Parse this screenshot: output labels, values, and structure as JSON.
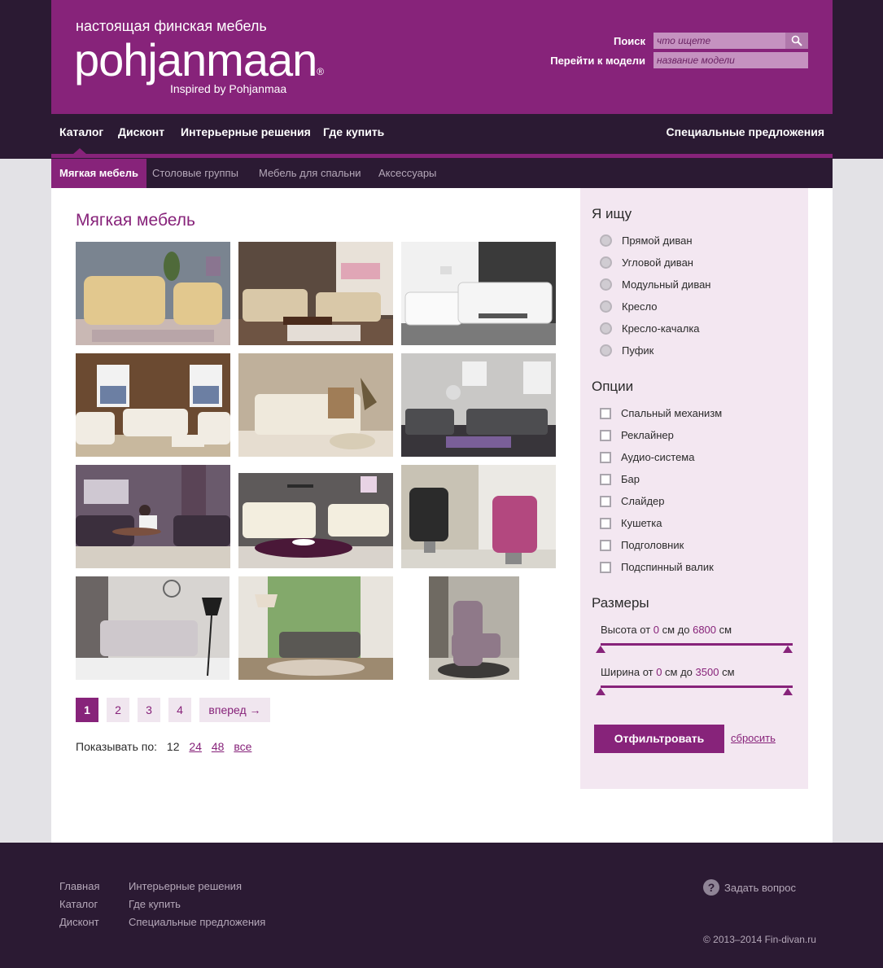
{
  "header": {
    "tagline": "настоящая финская мебель",
    "logo_text": "pohjanmaan",
    "logo_mark": "®",
    "logo_sub": "Inspired by Pohjanmaa",
    "search_label": "Поиск",
    "search_placeholder": "что ищете",
    "model_label": "Перейти к модели",
    "model_placeholder": "название модели"
  },
  "nav": {
    "items": [
      "Каталог",
      "Дисконт",
      "Интерьерные решения",
      "Где купить"
    ],
    "special": "Специальные предложения"
  },
  "subnav": [
    "Мягкая мебель",
    "Столовые группы",
    "Мебель для спальни",
    "Аксессуары"
  ],
  "main": {
    "title": "Мягкая мебель",
    "pagination": [
      "1",
      "2",
      "3",
      "4",
      "вперед →"
    ],
    "per_page_label": "Показывать по:",
    "per_page_options": [
      "12",
      "24",
      "48",
      "все"
    ]
  },
  "sidebar": {
    "looking_title": "Я ищу",
    "looking_options": [
      "Прямой диван",
      "Угловой диван",
      "Модульный диван",
      "Кресло",
      "Кресло-качалка",
      "Пуфик"
    ],
    "options_title": "Опции",
    "options": [
      "Спальный механизм",
      "Реклайнер",
      "Аудио-система",
      "Бар",
      "Слайдер",
      "Кушетка",
      "Подголовник",
      "Подспинный валик"
    ],
    "sizes_title": "Размеры",
    "height": {
      "prefix": "Высота от ",
      "from": "0",
      "mid": " см до ",
      "to": "6800",
      "suffix": " см"
    },
    "width": {
      "prefix": "Ширина от ",
      "from": "0",
      "mid": " см до ",
      "to": "3500",
      "suffix": " см"
    },
    "filter_button": "Отфильтровать",
    "reset_link": "сбросить"
  },
  "footer": {
    "col1": [
      "Главная",
      "Каталог",
      "Дисконт"
    ],
    "col2": [
      "Интерьерные решения",
      "Где купить",
      "Специальные предложения"
    ],
    "ask": "Задать вопрос",
    "ask_icon": "?",
    "copyright": "© 2013–2014 Fin-divan.ru"
  },
  "colors": {
    "brand": "#87237a",
    "dark": "#2b1a33",
    "sidebar_bg": "#f3e7f1"
  }
}
